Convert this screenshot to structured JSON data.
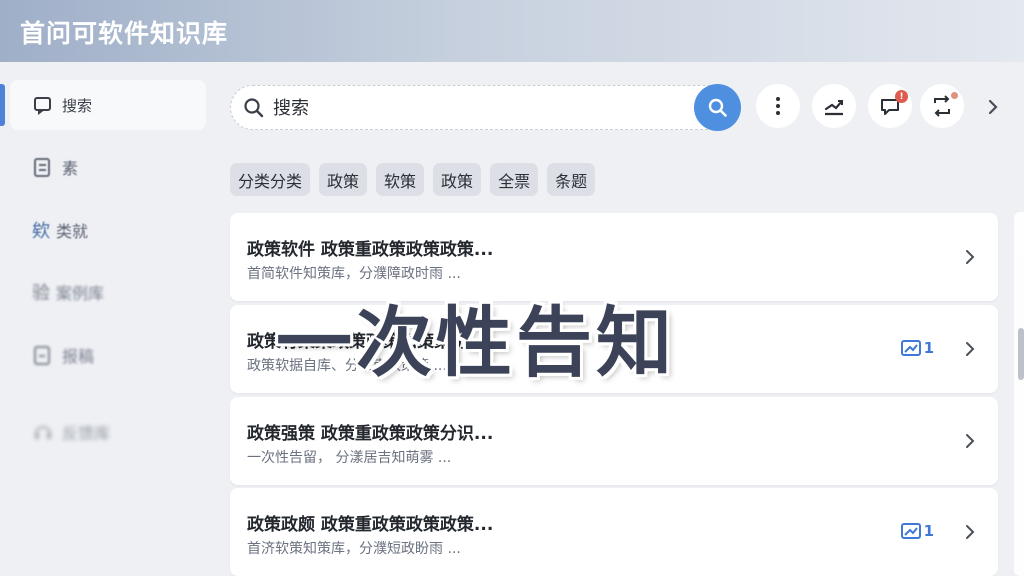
{
  "app": {
    "title": "首问可软件知识库"
  },
  "sidebar": {
    "items": [
      {
        "label": "搜索",
        "icon": "search-icon",
        "active": true
      },
      {
        "label": "素",
        "icon": "document-icon",
        "active": false
      },
      {
        "label": "类就",
        "icon": "category-icon",
        "prefix": "欸",
        "active": false
      },
      {
        "label": "案例库",
        "icon": "case-icon",
        "prefix": "验",
        "active": false
      },
      {
        "label": "报稿",
        "icon": "file-icon",
        "active": false
      },
      {
        "label": "反馈库",
        "icon": "headset-icon",
        "active": false
      }
    ]
  },
  "search": {
    "placeholder": "搜索",
    "value": ""
  },
  "toolbar": {
    "more": "more-vertical-icon",
    "trend": "trend-icon",
    "notify": "notification-icon",
    "notify_badge": "!",
    "share": "share-icon",
    "next": "chevron-right-icon"
  },
  "chips": [
    "分类分类",
    "政策",
    "软策",
    "政策",
    "全票",
    "条题"
  ],
  "results": [
    {
      "title": "政策软件 政策重政策政策政策...",
      "subtitle": "首简软件知策库，分濮障政时雨 ...",
      "attachments": ""
    },
    {
      "title": "政策有策策政策政策知策策访...",
      "subtitle": "政策软据自库、分濮南政策策 ...",
      "attachments": "1"
    },
    {
      "title": "政策强策 政策重政策政策分识...",
      "subtitle": "一次性告留， 分漾居吉知萌雾 ...",
      "attachments": ""
    },
    {
      "title": "政策政颇 政策重政策政策政策...",
      "subtitle": "首济软策知策库，分濮短政盼雨 ...",
      "attachments": "1"
    }
  ],
  "overlay": {
    "text": "一次性告知"
  },
  "colors": {
    "accent": "#4f8fe0",
    "badge": "#e05a4f",
    "active_bar": "#4e82d9"
  }
}
